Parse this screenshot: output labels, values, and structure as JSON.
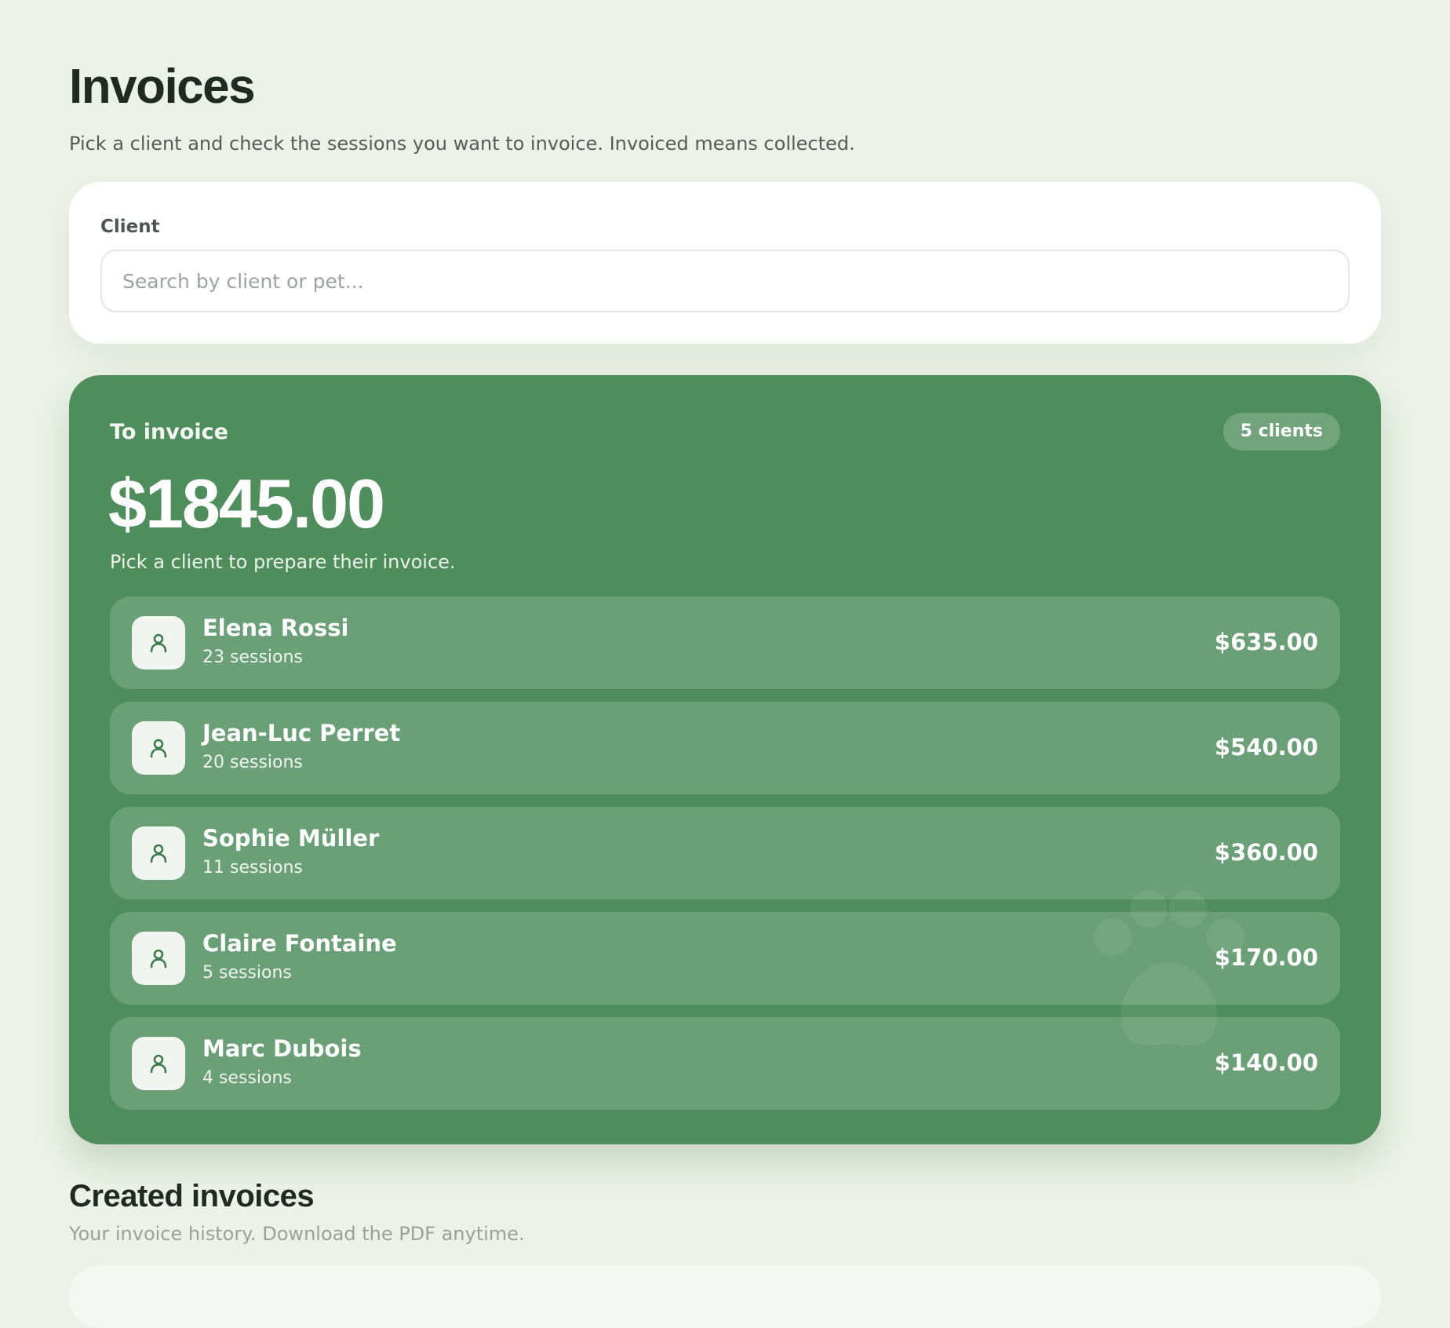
{
  "header": {
    "title": "Invoices",
    "subtitle": "Pick a client and check the sessions you want to invoice. Invoiced means collected."
  },
  "client_picker": {
    "label": "Client",
    "value": "",
    "placeholder": "Search by client or pet..."
  },
  "to_invoice": {
    "label": "To invoice",
    "badge": "5 clients",
    "total": "$1845.00",
    "hint": "Pick a client to prepare their invoice.",
    "clients": [
      {
        "name": "Elena Rossi",
        "sessions": "23 sessions",
        "amount": "$635.00"
      },
      {
        "name": "Jean-Luc Perret",
        "sessions": "20 sessions",
        "amount": "$540.00"
      },
      {
        "name": "Sophie Müller",
        "sessions": "11 sessions",
        "amount": "$360.00"
      },
      {
        "name": "Claire Fontaine",
        "sessions": "5 sessions",
        "amount": "$170.00"
      },
      {
        "name": "Marc Dubois",
        "sessions": "4 sessions",
        "amount": "$140.00"
      }
    ]
  },
  "history": {
    "title": "Created invoices",
    "subtitle": "Your invoice history. Download the PDF anytime."
  },
  "icons": {
    "avatar": "user-icon",
    "decoration": "paw-print-icon"
  },
  "colors": {
    "background": "#edf2e8",
    "accent": "#4f8d5d",
    "avatar_icon": "#3d7a4c"
  }
}
